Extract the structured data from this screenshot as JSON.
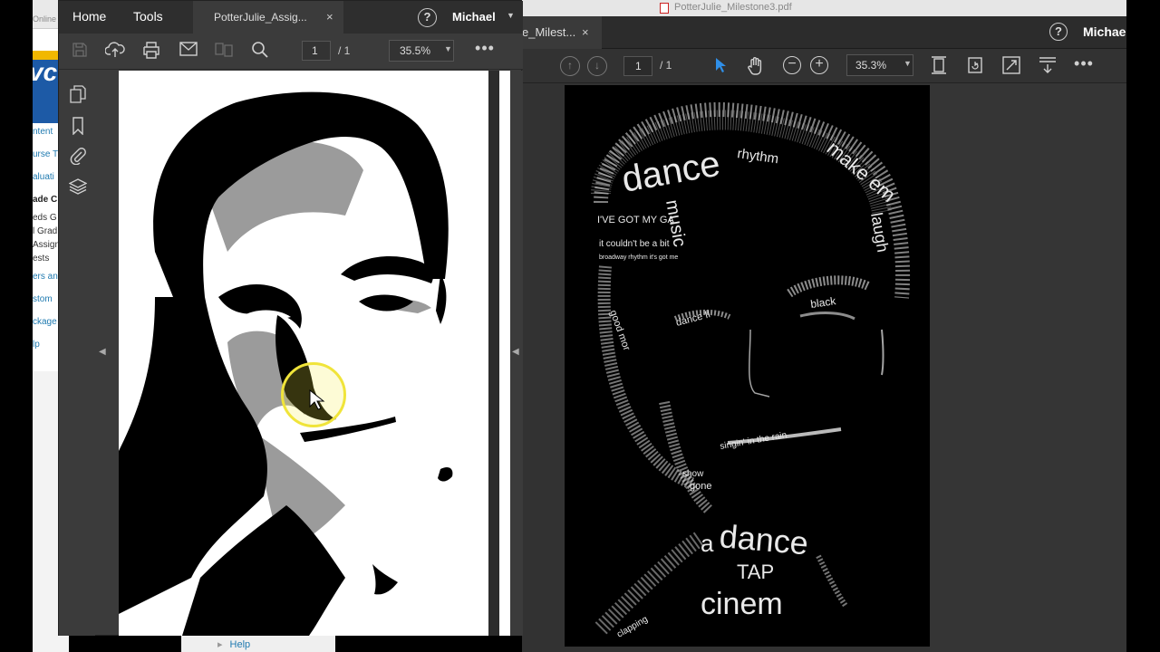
{
  "background_browser": {
    "tab_text": "Online",
    "nav_items": [
      "ntent",
      "urse T",
      "aluati",
      "ade C",
      "eds G",
      "l Grad",
      "Assign",
      "ests",
      "ers an",
      "stom",
      "ckage",
      "lp"
    ],
    "help_link": "Help"
  },
  "right_window": {
    "file_title": "PotterJulie_Milestone3.pdf",
    "tab_label": "e_Milest...",
    "tab_close": "×",
    "help": "?",
    "user": "Michae",
    "page_current": "1",
    "page_total": "/ 1",
    "zoom": "35.3%",
    "words": {
      "dance1": "dance",
      "rhythm": "rhythm",
      "make_em": "make em",
      "laugh": "laugh",
      "music": "music",
      "got_my": "I'VE GOT MY GA",
      "couldnt": "it couldn't be a bit",
      "broadway": "broadway rhythm it's got me",
      "good_mor": "good mor",
      "dancefl": "dance fl",
      "black": "black",
      "singin": "singin' in the rain",
      "show": "show",
      "gone": "gone",
      "dance2": "dance",
      "a": "a",
      "tap": "TAP",
      "cinema": "cinem",
      "clapping": "clapping"
    }
  },
  "left_window": {
    "menu_home": "Home",
    "menu_tools": "Tools",
    "tab_label": "PotterJulie_Assig...",
    "tab_close": "×",
    "help": "?",
    "user": "Michael",
    "page_current": "1",
    "page_total": "/ 1",
    "zoom": "35.5%"
  },
  "icons": {
    "left_toolbar": [
      "save-icon",
      "upload-icon",
      "print-icon",
      "email-icon",
      "compare-icon",
      "search-icon",
      "more-icon"
    ],
    "left_sidebar": [
      "pages-icon",
      "bookmark-icon",
      "attachment-icon",
      "layers-icon"
    ],
    "right_toolbar": [
      "prev-page-icon",
      "next-page-icon",
      "select-arrow-icon",
      "hand-icon",
      "zoom-out-icon",
      "zoom-in-icon",
      "fit-page-icon",
      "rotate-icon",
      "fullscreen-icon",
      "scroll-mode-icon",
      "more-icon"
    ]
  },
  "colors": {
    "acrobat_dark": "#323232",
    "select_blue": "#2f8fe8",
    "cursor_highlight": "#f0e43a"
  }
}
